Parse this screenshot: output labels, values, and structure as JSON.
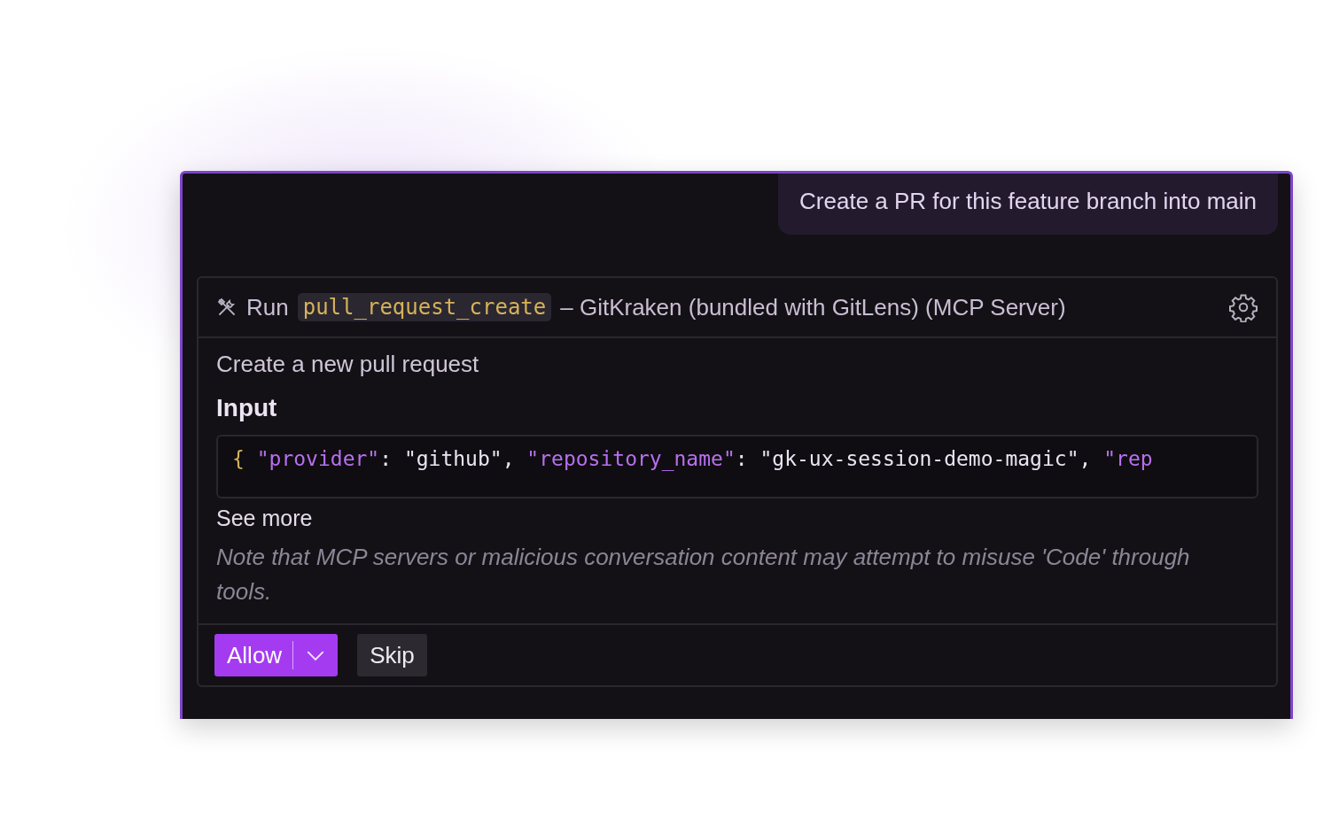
{
  "user_message": "Create a PR for this feature branch into main",
  "tool_call": {
    "run_label": "Run",
    "tool_name": "pull_request_create",
    "server": "– GitKraken (bundled with GitLens) (MCP Server)",
    "description": "Create a new pull request",
    "input_heading": "Input",
    "input_code": [
      {
        "kind": "punct",
        "text": "{ "
      },
      {
        "kind": "key",
        "text": "\"provider\""
      },
      {
        "kind": "plain",
        "text": ": \"github\", "
      },
      {
        "kind": "key",
        "text": "\"repository_name\""
      },
      {
        "kind": "plain",
        "text": ": \"gk-ux-session-demo-magic\", "
      },
      {
        "kind": "key",
        "text": "\"rep"
      }
    ],
    "see_more": "See more",
    "note": "Note that MCP servers or malicious conversation content may attempt to misuse 'Code' through tools.",
    "buttons": [
      {
        "kind": "primary",
        "label": "Allow",
        "has_dropdown": true
      },
      {
        "kind": "secondary",
        "label": "Skip",
        "has_dropdown": false
      }
    ]
  }
}
